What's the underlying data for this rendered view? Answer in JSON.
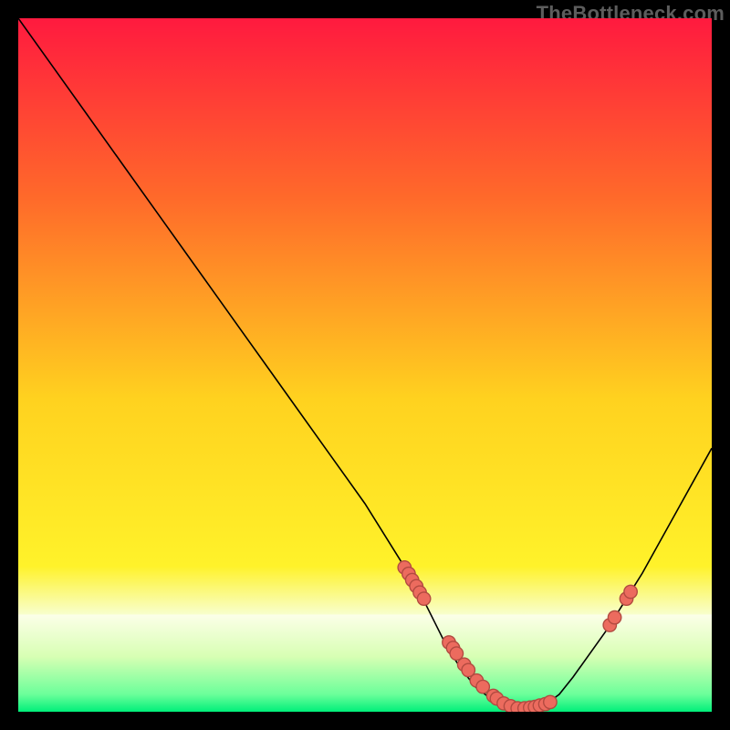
{
  "attribution": "TheBottleneck.com",
  "colors": {
    "curve": "#000000",
    "marker_fill": "#ec6b5e",
    "marker_stroke": "#b24a40",
    "grad_top": "#ff1a3f",
    "grad_mid": "#ffd21f",
    "grad_bottom": "#00ef7a",
    "greenish_band_top": "#f8ffcd",
    "greenish_band_mid": "#d8ffb4"
  },
  "chart_data": {
    "type": "line",
    "title": "",
    "xlabel": "",
    "ylabel": "",
    "xlim": [
      0,
      100
    ],
    "ylim": [
      0,
      100
    ],
    "curve": {
      "x": [
        0,
        5,
        10,
        15,
        20,
        25,
        30,
        35,
        40,
        45,
        50,
        55,
        58,
        60,
        62,
        64,
        66,
        68,
        70,
        72,
        74,
        76,
        78,
        80,
        85,
        90,
        95,
        100
      ],
      "y": [
        100,
        93,
        86,
        79,
        72,
        65,
        58,
        51,
        44,
        37,
        30,
        22,
        17,
        13,
        9,
        6,
        3.5,
        2,
        1,
        0.5,
        0.5,
        1,
        2.5,
        5,
        12,
        20,
        29,
        38
      ]
    },
    "markers": {
      "x": [
        55.7,
        56.3,
        56.8,
        57.4,
        57.9,
        58.5,
        62.1,
        62.7,
        63.2,
        64.3,
        64.9,
        66.1,
        67.0,
        68.5,
        69.0,
        70.0,
        71.0,
        72.0,
        73.0,
        73.8,
        74.5,
        75.2,
        76.0,
        76.7,
        85.3,
        86.0,
        87.7,
        88.3
      ],
      "y": [
        20.8,
        19.9,
        19.0,
        18.1,
        17.2,
        16.3,
        10.0,
        9.2,
        8.4,
        6.8,
        6.0,
        4.5,
        3.6,
        2.3,
        1.9,
        1.2,
        0.8,
        0.5,
        0.5,
        0.6,
        0.7,
        0.9,
        1.1,
        1.4,
        12.5,
        13.6,
        16.3,
        17.3
      ]
    }
  }
}
